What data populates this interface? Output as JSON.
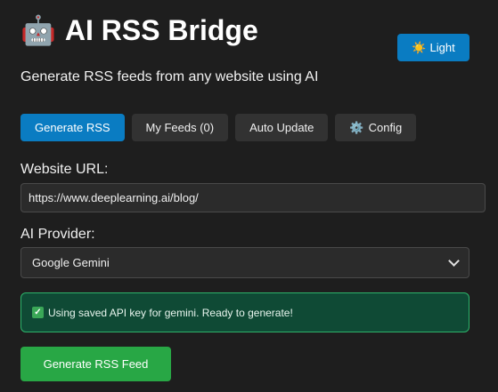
{
  "header": {
    "logo_emoji": "🤖",
    "title": "AI RSS Bridge",
    "subtitle": "Generate RSS feeds from any website using AI"
  },
  "theme_toggle": {
    "icon": "☀️",
    "label": "Light",
    "icon_name": "sun-icon"
  },
  "tabs": [
    {
      "label": "Generate RSS",
      "active": true
    },
    {
      "label": "My Feeds (0)",
      "active": false
    },
    {
      "label": "Auto Update",
      "active": false
    },
    {
      "label": "Config",
      "active": false,
      "icon": "⚙️",
      "icon_name": "gear-icon"
    }
  ],
  "form": {
    "url_label": "Website URL:",
    "url_value": "https://www.deeplearning.ai/blog/",
    "provider_label": "AI Provider:",
    "provider_selected": "Google Gemini"
  },
  "status": {
    "icon": "✓",
    "icon_name": "check-icon",
    "message": "Using saved API key for gemini. Ready to generate!"
  },
  "actions": {
    "generate_label": "Generate RSS Feed"
  },
  "colors": {
    "background": "#1e1e1e",
    "accent_blue": "#0a7cc2",
    "success_green": "#28a745",
    "status_bg": "#0f4a35",
    "status_border": "#2db36a"
  }
}
